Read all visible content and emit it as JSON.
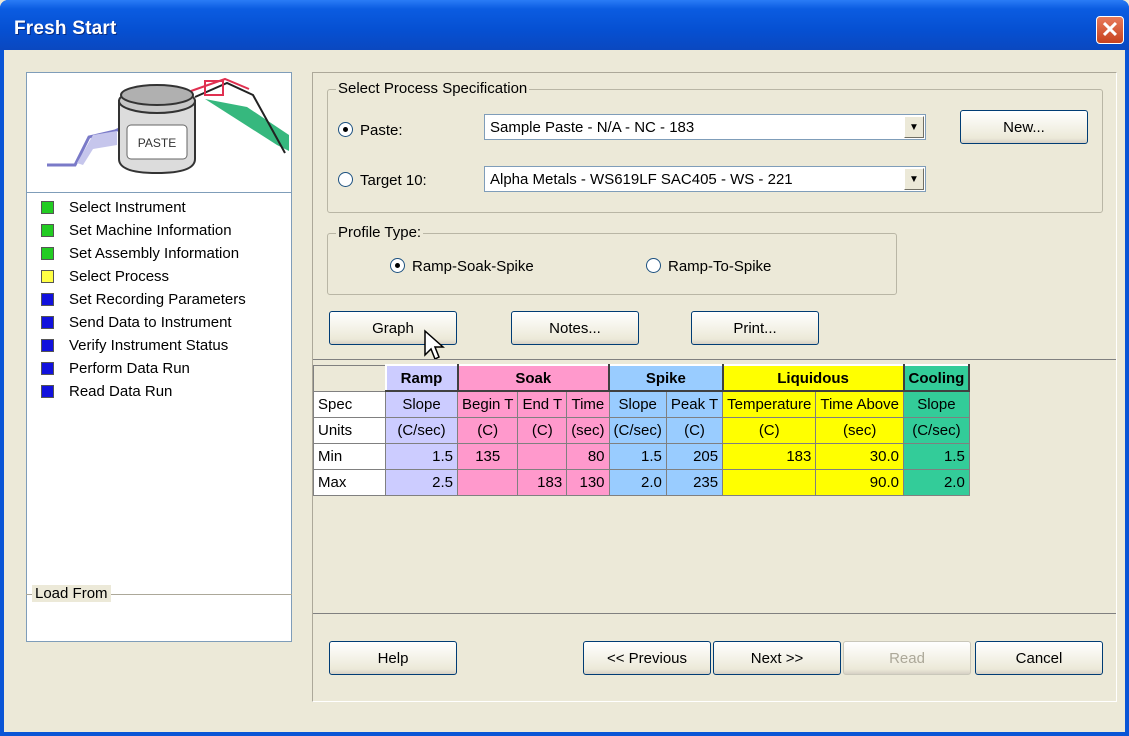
{
  "window": {
    "title": "Fresh Start"
  },
  "steps": [
    {
      "label": "Select Instrument",
      "color": "#22cc22"
    },
    {
      "label": "Set Machine Information",
      "color": "#22cc22"
    },
    {
      "label": "Set Assembly Information",
      "color": "#22cc22"
    },
    {
      "label": "Select Process",
      "color": "#ffff44"
    },
    {
      "label": "Set Recording Parameters",
      "color": "#1111dd"
    },
    {
      "label": "Send Data to Instrument",
      "color": "#1111dd"
    },
    {
      "label": "Verify Instrument Status",
      "color": "#1111dd"
    },
    {
      "label": "Perform Data Run",
      "color": "#1111dd"
    },
    {
      "label": "Read Data Run",
      "color": "#1111dd"
    }
  ],
  "illustration": {
    "jar_label": "PASTE"
  },
  "load_from": {
    "label": "Load From"
  },
  "process_spec": {
    "group_label": "Select Process Specification",
    "paste_label": "Paste:",
    "paste_value": "Sample Paste - N/A - NC - 183",
    "target_label": "Target 10:",
    "target_value": "Alpha Metals - WS619LF SAC405 - WS - 221",
    "new_button": "New...",
    "selected": "paste"
  },
  "profile_type": {
    "group_label": "Profile Type:",
    "option1": "Ramp-Soak-Spike",
    "option2": "Ramp-To-Spike",
    "selected": "Ramp-Soak-Spike"
  },
  "actions": {
    "graph": "Graph",
    "notes": "Notes...",
    "print": "Print..."
  },
  "table": {
    "groups": {
      "ramp": "Ramp",
      "soak": "Soak",
      "spike": "Spike",
      "liquidous": "Liquidous",
      "cooling": "Cooling"
    },
    "row_labels": {
      "spec": "Spec",
      "units": "Units",
      "min": "Min",
      "max": "Max"
    },
    "spec": [
      "Slope",
      "Begin T",
      "End T",
      "Time",
      "Slope",
      "Peak T",
      "Temperature",
      "Time Above",
      "Slope"
    ],
    "units": [
      "(C/sec)",
      "(C)",
      "(C)",
      "(sec)",
      "(C/sec)",
      "(C)",
      "(C)",
      "(sec)",
      "(C/sec)"
    ],
    "min": [
      "1.5",
      "135",
      "",
      "80",
      "1.5",
      "205",
      "183",
      "30.0",
      "1.5"
    ],
    "max": [
      "2.5",
      "",
      "183",
      "130",
      "2.0",
      "235",
      "",
      "90.0",
      "2.0"
    ]
  },
  "footer": {
    "help": "Help",
    "previous": "<< Previous",
    "next": "Next >>",
    "read": "Read",
    "cancel": "Cancel"
  }
}
